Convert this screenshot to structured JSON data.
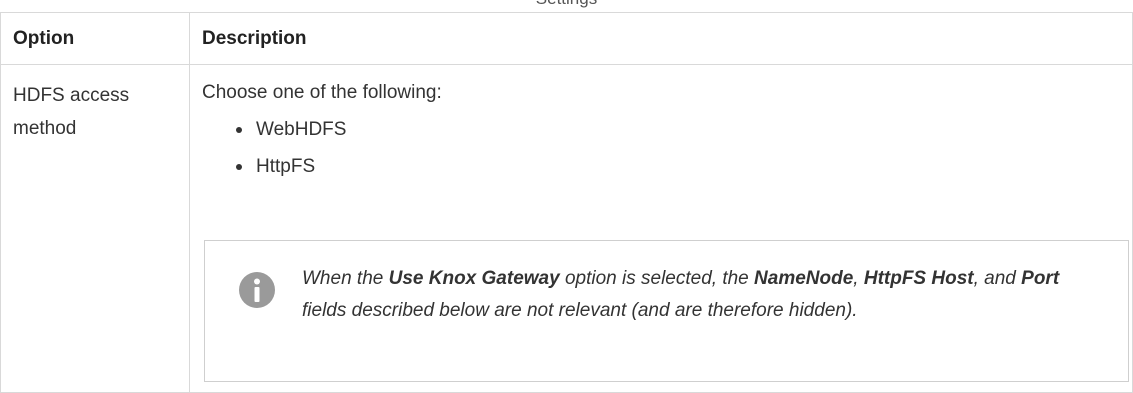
{
  "caption": "Settings",
  "table": {
    "headers": {
      "option": "Option",
      "description": "Description"
    },
    "row": {
      "option": "HDFS access method",
      "intro": "Choose one of the following:",
      "methods": [
        "WebHDFS",
        "HttpFS"
      ]
    }
  },
  "note": {
    "icon": "info-icon",
    "parts": [
      "When the ",
      "Use Knox Gateway",
      " option is selected, the ",
      "NameNode",
      ", ",
      "HttpFS Host",
      ", and ",
      "Port",
      " fields described below are not relevant (and are therefore hidden)."
    ]
  },
  "colors": {
    "border": "#d9d9d9",
    "icon": "#9a9a9a",
    "text": "#333333"
  }
}
